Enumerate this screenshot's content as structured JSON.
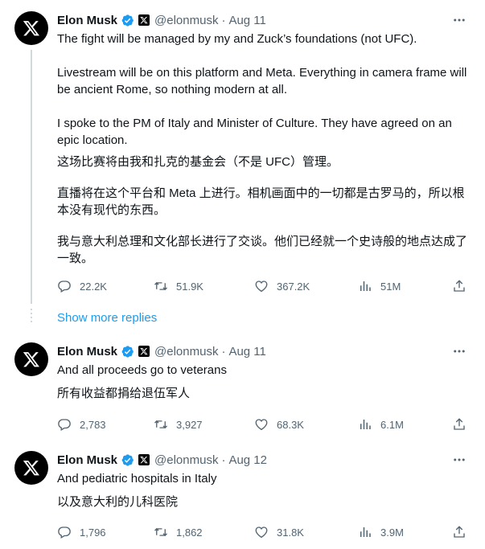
{
  "tweets": [
    {
      "name": "Elon Musk",
      "handle": "@elonmusk",
      "dot": "·",
      "date": "Aug 11",
      "english": [
        "The fight will be managed by my and Zuck’s foundations (not UFC).",
        "Livestream will be on this platform and Meta. Everything in camera frame will be ancient Rome, so nothing modern at all.",
        "I spoke to the PM of Italy and Minister of Culture. They have agreed on an epic location."
      ],
      "chinese": [
        "这场比赛将由我和扎克的基金会（不是 UFC）管理。",
        "直播将在这个平台和 Meta 上进行。相机画面中的一切都是古罗马的，所以根本没有现代的东西。",
        "我与意大利总理和文化部长进行了交谈。他们已经就一个史诗般的地点达成了一致。"
      ],
      "replies": "22.2K",
      "retweets": "51.9K",
      "likes": "367.2K",
      "views": "51M"
    },
    {
      "name": "Elon Musk",
      "handle": "@elonmusk",
      "dot": "·",
      "date": "Aug 11",
      "english": [
        "And all proceeds go to veterans"
      ],
      "chinese": [
        "所有收益都捐给退伍军人"
      ],
      "replies": "2,783",
      "retweets": "3,927",
      "likes": "68.3K",
      "views": "6.1M"
    },
    {
      "name": "Elon Musk",
      "handle": "@elonmusk",
      "dot": "·",
      "date": "Aug 12",
      "english": [
        "And pediatric hospitals in Italy"
      ],
      "chinese": [
        "以及意大利的儿科医院"
      ],
      "replies": "1,796",
      "retweets": "1,862",
      "likes": "31.8K",
      "views": "3.9M"
    }
  ],
  "show_more_replies": "Show more replies",
  "icons": {
    "avatar": "x-logo-icon",
    "verified": "verified-badge-icon",
    "affiliate": "x-affiliate-badge-icon",
    "more": "more-horizontal-icon",
    "reply": "reply-icon",
    "retweet": "retweet-icon",
    "like": "heart-icon",
    "views": "views-chart-icon",
    "share": "share-icon"
  },
  "colors": {
    "text": "#0f1419",
    "secondary": "#536471",
    "link": "#1d9bf0",
    "verified": "#1d9bf0",
    "thread_line": "#cfd9de"
  }
}
